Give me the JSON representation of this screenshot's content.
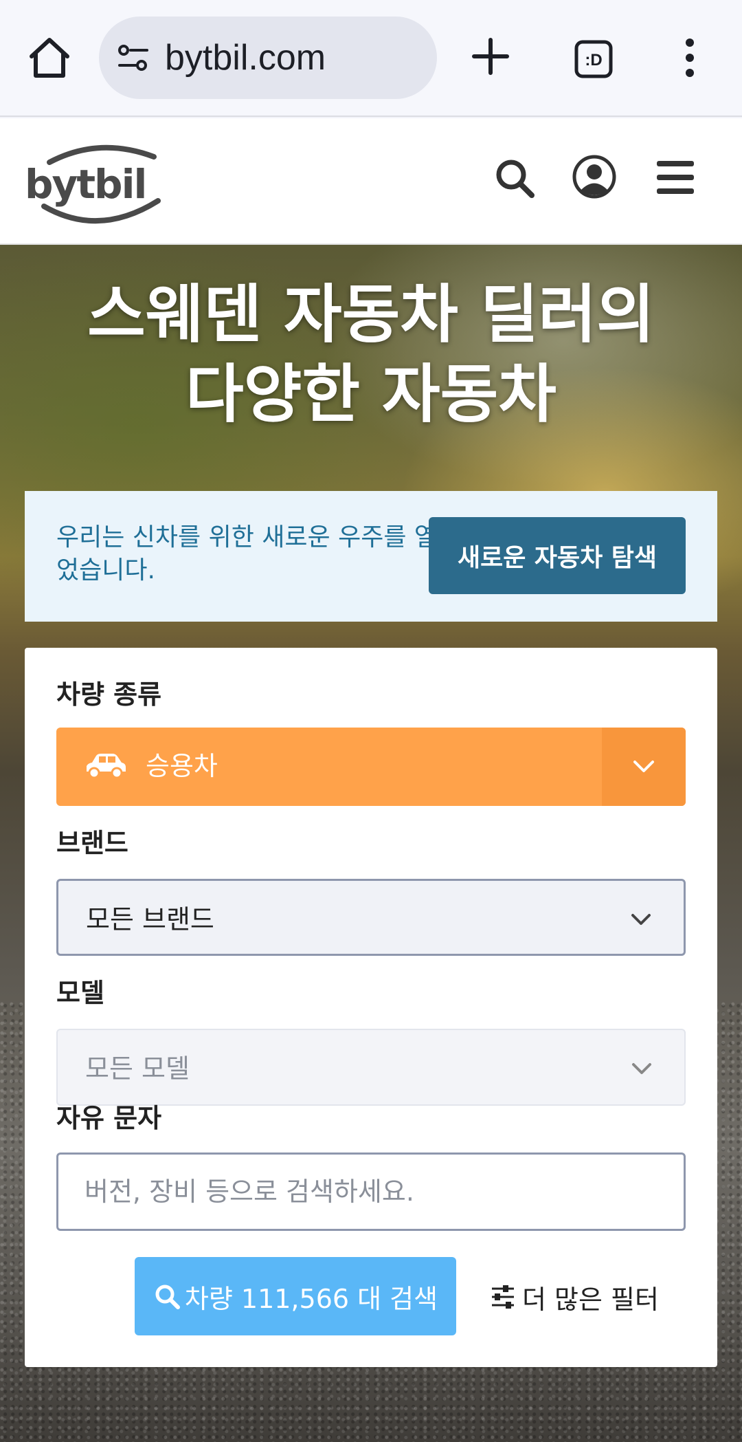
{
  "browser": {
    "url": "bytbil.com",
    "tabs_label": ":D"
  },
  "site": {
    "logo_text": "bytbil"
  },
  "hero": {
    "title_line1": "스웨덴 자동차 딜러의",
    "title_line2": "다양한 자동차"
  },
  "promo": {
    "text": "우리는 신차를 위한 새로운 우주를 열었습니다.",
    "button_label": "새로운 자동차 탐색"
  },
  "search": {
    "vehicle_type_label": "차량 종류",
    "vehicle_type_value": "승용차",
    "brand_label": "브랜드",
    "brand_value": "모든 브랜드",
    "model_label": "모델",
    "model_value": "모든 모델",
    "freetext_label": "자유 문자",
    "freetext_placeholder": "버전, 장비 등으로 검색하세요.",
    "search_button_label": "차량 111,566 대 검색",
    "more_filters_label": "더 많은 필터"
  },
  "colors": {
    "vehicle_select_bg": "#ffa24a",
    "promo_button_bg": "#2c6b8c",
    "search_button_bg": "#5ab7f7",
    "promo_bg": "#eaf4fb"
  }
}
